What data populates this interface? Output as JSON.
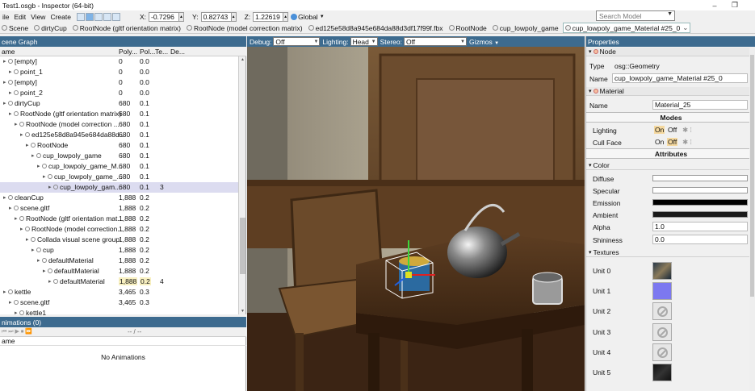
{
  "window": {
    "title": "Test1.osgb - Inspector (64-bit)",
    "controls": [
      "–",
      "❐"
    ]
  },
  "menu": [
    "ile",
    "Edit",
    "View",
    "Create"
  ],
  "toolbar": {
    "x_label": "X:",
    "x_value": "-0.7296",
    "y_label": "Y:",
    "y_value": "0.82743",
    "z_label": "Z:",
    "z_value": "1.22619",
    "space": "Global"
  },
  "search": {
    "placeholder": "Search Model"
  },
  "breadcrumb": [
    "Scene",
    "dirtyCup",
    "RootNode (gltf orientation matrix)",
    "RootNode (model correction matrix)",
    "ed125e58d8a945e684da88d3df17f99f.fbx",
    "RootNode",
    "cup_lowpoly_game",
    "cup_lowpoly_game_Material #25_0"
  ],
  "scene_graph": {
    "title": "cene Graph",
    "columns": {
      "name": "ame",
      "poly": "Poly...",
      "pol": "Pol...",
      "te": "Te...",
      "de": "De..."
    },
    "rows": [
      {
        "name": "[empty]",
        "poly": "0",
        "pol": "0.0",
        "te": "",
        "indent": 0
      },
      {
        "name": "point_1",
        "poly": "0",
        "pol": "0.0",
        "te": "",
        "indent": 1
      },
      {
        "name": "[empty]",
        "poly": "0",
        "pol": "0.0",
        "te": "",
        "indent": 0
      },
      {
        "name": "point_2",
        "poly": "0",
        "pol": "0.0",
        "te": "",
        "indent": 1
      },
      {
        "name": "dirtyCup",
        "poly": "680",
        "pol": "0.1",
        "te": "",
        "indent": 0
      },
      {
        "name": "RootNode (gltf orientation matrix)",
        "poly": "680",
        "pol": "0.1",
        "te": "",
        "indent": 1
      },
      {
        "name": "RootNode (model correction ...",
        "poly": "680",
        "pol": "0.1",
        "te": "",
        "indent": 2
      },
      {
        "name": "ed125e58d8a945e684da88d...",
        "poly": "680",
        "pol": "0.1",
        "te": "",
        "indent": 3
      },
      {
        "name": "RootNode",
        "poly": "680",
        "pol": "0.1",
        "te": "",
        "indent": 4
      },
      {
        "name": "cup_lowpoly_game",
        "poly": "680",
        "pol": "0.1",
        "te": "",
        "indent": 5
      },
      {
        "name": "cup_lowpoly_game_M...",
        "poly": "680",
        "pol": "0.1",
        "te": "",
        "indent": 6
      },
      {
        "name": "cup_lowpoly_game_...",
        "poly": "680",
        "pol": "0.1",
        "te": "",
        "indent": 7
      },
      {
        "name": "cup_lowpoly_gam...",
        "poly": "680",
        "pol": "0.1",
        "te": "3",
        "indent": 8,
        "selected": true
      },
      {
        "name": "cleanCup",
        "poly": "1,888",
        "pol": "0.2",
        "te": "",
        "indent": 0
      },
      {
        "name": "scene.gltf",
        "poly": "1,888",
        "pol": "0.2",
        "te": "",
        "indent": 1
      },
      {
        "name": "RootNode (gltf orientation mat...",
        "poly": "1,888",
        "pol": "0.2",
        "te": "",
        "indent": 2
      },
      {
        "name": "RootNode (model correction...",
        "poly": "1,888",
        "pol": "0.2",
        "te": "",
        "indent": 3
      },
      {
        "name": "Collada visual scene group",
        "poly": "1,888",
        "pol": "0.2",
        "te": "",
        "indent": 4
      },
      {
        "name": "cup",
        "poly": "1,888",
        "pol": "0.2",
        "te": "",
        "indent": 5
      },
      {
        "name": "defaultMaterial",
        "poly": "1,888",
        "pol": "0.2",
        "te": "",
        "indent": 6
      },
      {
        "name": "defaultMaterial",
        "poly": "1,888",
        "pol": "0.2",
        "te": "",
        "indent": 7
      },
      {
        "name": "defaultMaterial",
        "poly": "1,888",
        "pol": "0.2",
        "te": "4",
        "indent": 8,
        "yellow": true
      },
      {
        "name": "kettle",
        "poly": "3,465",
        "pol": "0.3",
        "te": "",
        "indent": 0
      },
      {
        "name": "scene.gltf",
        "poly": "3,465",
        "pol": "0.3",
        "te": "",
        "indent": 1
      },
      {
        "name": "kettle1",
        "poly": "",
        "pol": "",
        "te": "",
        "indent": 2
      }
    ]
  },
  "animations": {
    "title": "nimations (0)",
    "time": "-- / --",
    "column": "ame",
    "empty": "No Animations"
  },
  "viewport": {
    "debug_label": "Debug:",
    "debug_value": "Off",
    "lighting_label": "Lighting:",
    "lighting_value": "Head",
    "stereo_label": "Stereo:",
    "stereo_value": "Off",
    "gizmos_label": "Gizmos"
  },
  "properties": {
    "title": "Properties",
    "node_section": "Node",
    "type_label": "Type",
    "type_value": "osg::Geometry",
    "name_label": "Name",
    "name_value": "cup_lowpoly_game_Material #25_0",
    "material_section": "Material",
    "mat_name_label": "Name",
    "mat_name_value": "Material_25",
    "modes_header": "Modes",
    "lighting_label": "Lighting",
    "lighting_on": "On",
    "lighting_off": "Off",
    "cullface_label": "Cull Face",
    "cullface_on": "On",
    "cullface_off": "Off",
    "attributes_header": "Attributes",
    "color_section": "Color",
    "diffuse_label": "Diffuse",
    "specular_label": "Specular",
    "emission_label": "Emission",
    "ambient_label": "Ambient",
    "alpha_label": "Alpha",
    "alpha_value": "1.0",
    "shininess_label": "Shininess",
    "shininess_value": "0.0",
    "textures_section": "Textures",
    "units": [
      "Unit 0",
      "Unit 1",
      "Unit 2",
      "Unit 3",
      "Unit 4",
      "Unit 5"
    ]
  },
  "colors": {
    "header_blue": "#3d6b8f",
    "diffuse": "#ffffff",
    "specular": "#ffffff",
    "emission": "#000000",
    "ambient": "#1a1a1a"
  }
}
